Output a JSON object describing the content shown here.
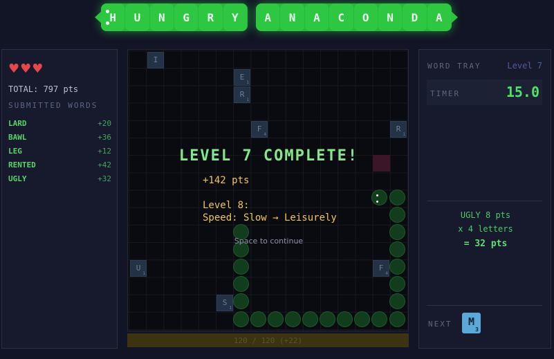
{
  "title": {
    "word1": [
      "H",
      "U",
      "N",
      "G",
      "R",
      "Y"
    ],
    "word2": [
      "A",
      "N",
      "A",
      "C",
      "O",
      "N",
      "D",
      "A"
    ],
    "color": "#2ec742"
  },
  "left_panel": {
    "hearts": "♥♥♥",
    "total": "TOTAL: 797 pts",
    "submitted_label": "SUBMITTED WORDS",
    "words": [
      {
        "word": "LARD",
        "pts": "+20"
      },
      {
        "word": "BAWL",
        "pts": "+36"
      },
      {
        "word": "LEG",
        "pts": "+12"
      },
      {
        "word": "RENTED",
        "pts": "+42"
      },
      {
        "word": "UGLY",
        "pts": "+32"
      }
    ]
  },
  "right_panel": {
    "word_tray_label": "WORD TRAY",
    "level_label": "Level 7",
    "timer_label": "TIMER",
    "timer_value": "15.0",
    "score_word": "UGLY 8 pts",
    "score_mult": "x 4 letters",
    "score_total": "= 32 pts",
    "next_label": "NEXT",
    "next_letter": "M",
    "next_value": "3"
  },
  "board": {
    "tiles": [
      {
        "letter": "I",
        "value": ""
      },
      {
        "letter": "E",
        "value": "1"
      },
      {
        "letter": "R",
        "value": "1"
      },
      {
        "letter": "F",
        "value": "4"
      },
      {
        "letter": "R",
        "value": "1"
      },
      {
        "letter": "U",
        "value": "1"
      },
      {
        "letter": "F",
        "value": "4"
      },
      {
        "letter": "S",
        "value": "1"
      }
    ],
    "overlay": {
      "title": "LEVEL 7 COMPLETE!",
      "points": "+142 pts",
      "next_level": "Level 8:",
      "speed": "Speed: Slow → Leisurely",
      "hint": "Space to continue"
    }
  },
  "progress": {
    "text": "120 / 120 (+22)",
    "fraction": 1.0
  },
  "colors": {
    "accent_green": "#2ec742",
    "heart_red": "#e8464d",
    "overlay_yellow": "#f3c64c",
    "snake_dark": "#113d1d"
  }
}
